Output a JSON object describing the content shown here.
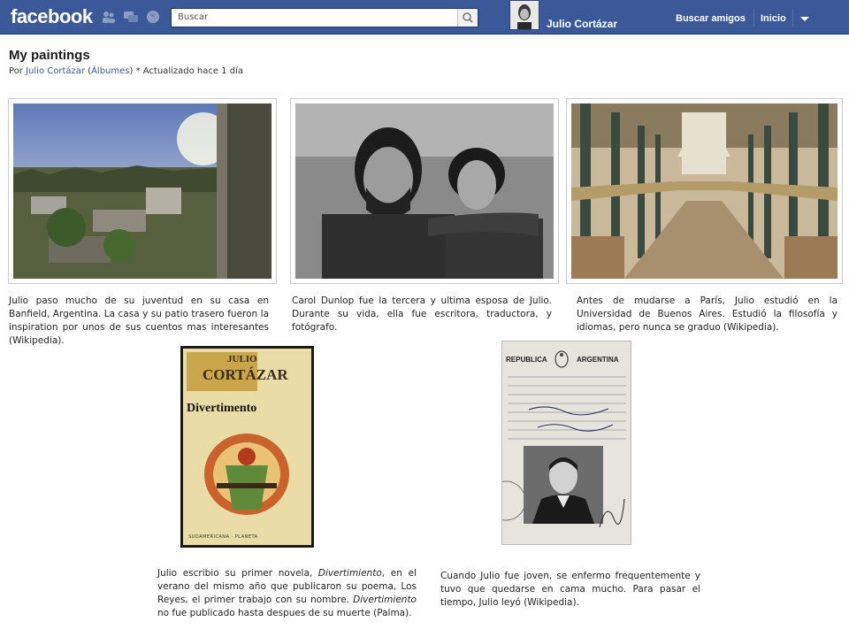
{
  "topbar": {
    "logo": "facebook",
    "search_placeholder": "Buscar",
    "user_name": "Julio Cortázar",
    "nav": [
      "Buscar amigos",
      "Inicio"
    ]
  },
  "album": {
    "title": "My paintings",
    "by_prefix": "Por ",
    "author": "Julio Cortázar",
    "albums_link": "Álbumes",
    "updated": " * Actualizado hace 1 día"
  },
  "photos": [
    {
      "caption": "Julio paso mucho de su juventud en su casa en Banfield, Argentina. La casa y su patio trasero fueron la inspiration por unos de sus cuentos mas interesantes (Wikipedia)."
    },
    {
      "caption": "Carol Dunlop fue la tercera y ultima esposa de Julio. Durante su vida, ella fue escritora, traductora, y fotógrafo."
    },
    {
      "caption": "Antes de mudarse a París, Julio estudió en la Universidad de Buenos Aires. Estudió la filosofía y idiomas, pero nunca se graduo (Wikipedia)."
    },
    {
      "caption_parts": [
        "Julio escribio su primer novela, ",
        "Divertimiento",
        ", en el verano del mismo año que publicaron su poema, Los Reyes, el primer trabajo con su nombre. ",
        "Divertimiento",
        " no fue publicado hasta despues de su muerte (Palma)."
      ]
    },
    {
      "caption": "Cuando Julio fue joven, se enfermo frequentemente y tuvo que quedarse en cama mucho. Para pasar el tiempo, Julio leyó (Wikipedia)."
    }
  ],
  "book_cover": {
    "line1": "JULIO",
    "line2": "CORTÁZAR",
    "line3": "Divertimento",
    "publisher": "SUDAMERICANA · PLANETA"
  },
  "id_card": {
    "header_left": "REPUBLICA",
    "header_right": "ARGENTINA"
  },
  "colors": {
    "brand": "#3b5998",
    "link": "#3b5998"
  }
}
